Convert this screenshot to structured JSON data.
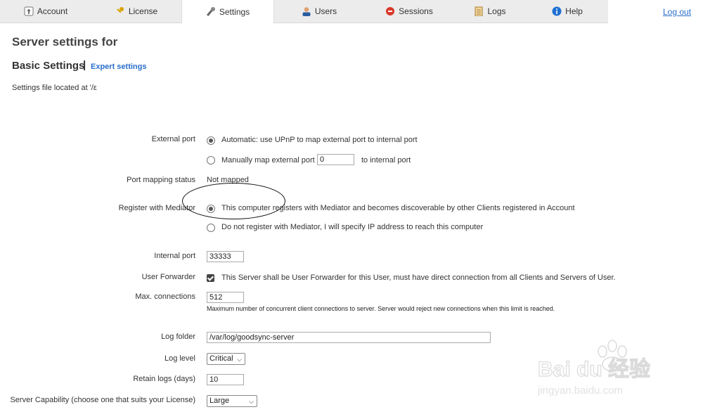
{
  "nav": {
    "tabs": [
      {
        "label": "Account",
        "icon": "account-icon"
      },
      {
        "label": "License",
        "icon": "key-icon"
      },
      {
        "label": "Settings",
        "icon": "wrench-icon"
      },
      {
        "label": "Users",
        "icon": "user-icon"
      },
      {
        "label": "Sessions",
        "icon": "sessions-icon"
      },
      {
        "label": "Logs",
        "icon": "logs-icon"
      },
      {
        "label": "Help",
        "icon": "info-icon"
      }
    ],
    "active_tab": "Settings",
    "logout_label": "Log out"
  },
  "page": {
    "title": "Server settings for",
    "subtitle": "Basic Settings",
    "separator": "|",
    "expert_link": "Expert settings",
    "file_location": "Settings file located at '/ε"
  },
  "form": {
    "external_port": {
      "label": "External port",
      "option_auto": "Automatic: use UPnP to map external port to internal port",
      "option_manual_prefix": "Manually map external port",
      "manual_value": "0",
      "option_manual_suffix": "to internal port",
      "selected": "auto"
    },
    "port_mapping_status": {
      "label": "Port mapping status",
      "value": "Not mapped"
    },
    "mediator": {
      "label": "Register with Mediator",
      "option_register": "This computer registers with Mediator and becomes discoverable by other Clients registered in Account",
      "option_no_register": "Do not register with Mediator, I will specify IP address to reach this computer",
      "selected": "register"
    },
    "internal_port": {
      "label": "Internal port",
      "value": "33333"
    },
    "user_forwarder": {
      "label": "User Forwarder",
      "checked": true,
      "text": "This Server shall be User Forwarder for this User, must have direct connection from all Clients and Servers of User."
    },
    "max_connections": {
      "label": "Max. connections",
      "value": "512",
      "hint": "Maximum number of concurrent client connections to server. Server would reject new connections when this limit is reached."
    },
    "log_folder": {
      "label": "Log folder",
      "value": "/var/log/goodsync-server"
    },
    "log_level": {
      "label": "Log level",
      "value": "Critical"
    },
    "retain_logs": {
      "label": "Retain logs (days)",
      "value": "10"
    },
    "server_capability": {
      "label": "Server Capability (choose one that suits your License)",
      "value": "Large"
    }
  },
  "watermark": {
    "brand": "Bai du 经验",
    "url": "jingyan.baidu.com"
  },
  "colors": {
    "link": "#2a6fcc",
    "nav_bg": "#ececec"
  }
}
